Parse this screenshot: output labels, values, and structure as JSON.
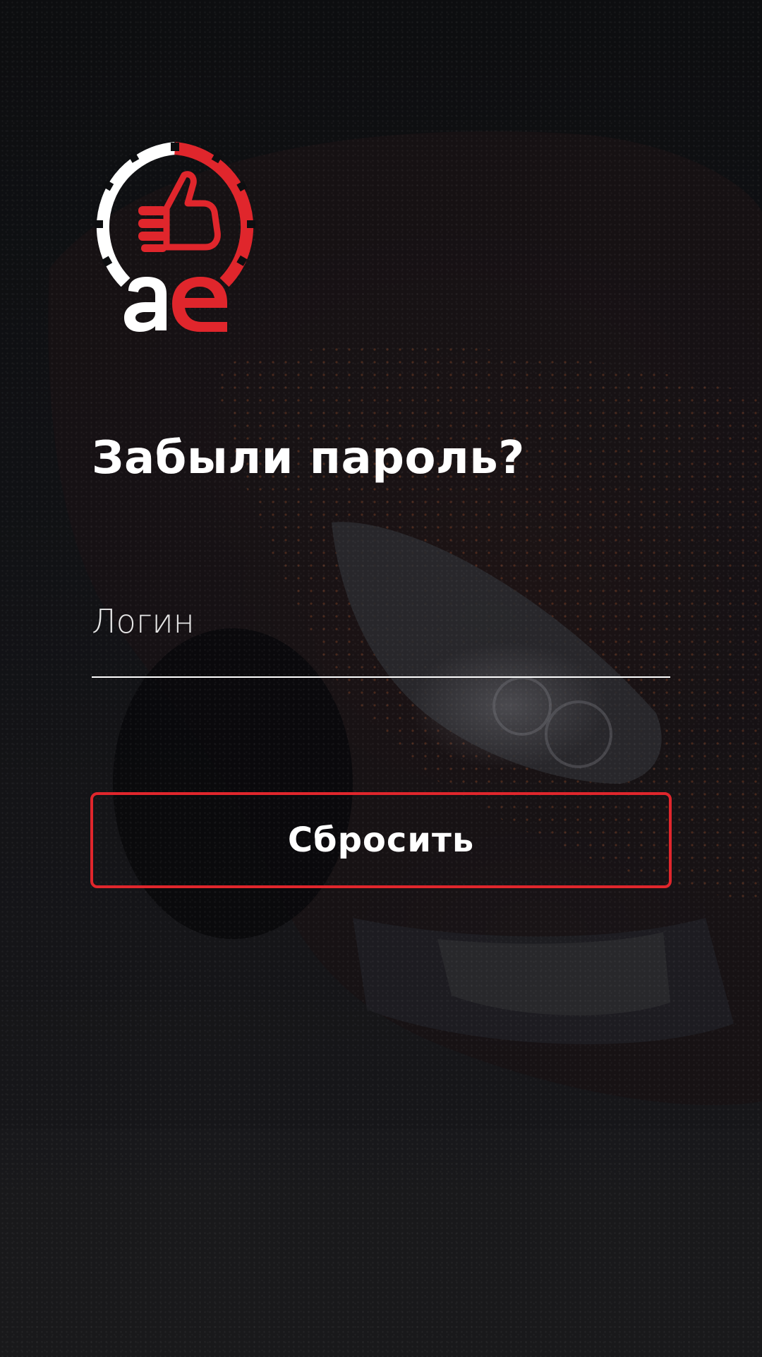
{
  "logo": {
    "icon": "speedometer-thumbs-up-logo",
    "wordmark": "ae",
    "accent_color": "#e0262c",
    "primary_color": "#ffffff"
  },
  "screen": {
    "title": "Забыли пароль?"
  },
  "login_field": {
    "placeholder": "Логин",
    "value": ""
  },
  "reset_button": {
    "label": "Сбросить",
    "border_color": "#e0262c"
  },
  "background": {
    "subject": "dark-sports-car-photo"
  }
}
